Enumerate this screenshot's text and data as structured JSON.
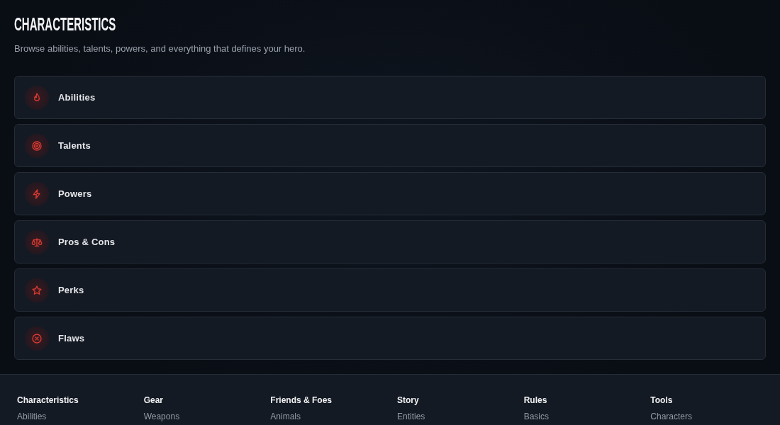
{
  "header": {
    "title": "CHARACTERISTICS",
    "subtitle": "Browse abilities, talents, powers, and everything that defines your hero."
  },
  "categories": [
    {
      "label": "Abilities"
    },
    {
      "label": "Talents"
    },
    {
      "label": "Powers"
    },
    {
      "label": "Pros & Cons"
    },
    {
      "label": "Perks"
    },
    {
      "label": "Flaws"
    }
  ],
  "footer": {
    "columns": [
      {
        "heading": "Characteristics",
        "links": [
          "Abilities"
        ]
      },
      {
        "heading": "Gear",
        "links": [
          "Weapons"
        ]
      },
      {
        "heading": "Friends & Foes",
        "links": [
          "Animals"
        ]
      },
      {
        "heading": "Story",
        "links": [
          "Entities"
        ]
      },
      {
        "heading": "Rules",
        "links": [
          "Basics"
        ]
      },
      {
        "heading": "Tools",
        "links": [
          "Characters"
        ]
      }
    ]
  }
}
